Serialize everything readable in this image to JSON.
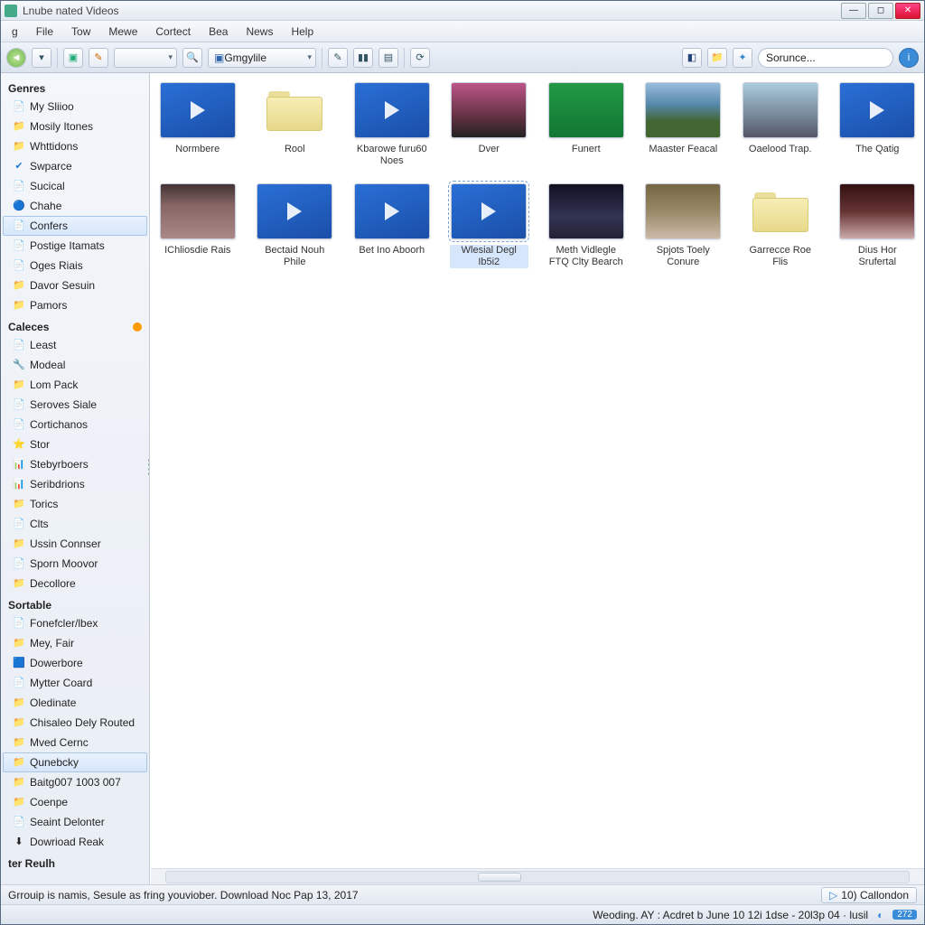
{
  "titlebar": {
    "title": "Lnube nated Videos"
  },
  "menu": {
    "items": [
      "File",
      "Tow",
      "Mewe",
      "Cortect",
      "Bea",
      "News",
      "Help"
    ],
    "first_partial": "g"
  },
  "toolbar": {
    "dropdown1_label": "",
    "dropdown2_label": "Gmgylile",
    "search_placeholder": "Sorunce..."
  },
  "sidebar": {
    "genres_header": "Genres",
    "genres": [
      {
        "icon": "📄",
        "label": "My Sliioo"
      },
      {
        "icon": "📁",
        "label": "Mosily Itones"
      },
      {
        "icon": "📁",
        "label": "Whttidons"
      },
      {
        "icon": "✔",
        "label": "Swparce",
        "blue": true
      },
      {
        "icon": "📄",
        "label": "Sucical"
      },
      {
        "icon": "🔵",
        "label": "Chahe"
      },
      {
        "icon": "📄",
        "label": "Confers",
        "selected": true
      },
      {
        "icon": "📄",
        "label": "Postige Itamats"
      },
      {
        "icon": "📄",
        "label": "Oges Riais"
      },
      {
        "icon": "📁",
        "label": "Davor Sesuin"
      },
      {
        "icon": "📁",
        "label": "Pamors"
      }
    ],
    "caleces_header": "Caleces",
    "caleces": [
      {
        "icon": "📄",
        "label": "Least"
      },
      {
        "icon": "🔧",
        "label": "Modeal"
      },
      {
        "icon": "📁",
        "label": "Lom Pack"
      },
      {
        "icon": "📄",
        "label": "Seroves Siale"
      },
      {
        "icon": "📄",
        "label": "Cortichanos"
      },
      {
        "icon": "⭐",
        "label": "Stor"
      },
      {
        "icon": "📊",
        "label": "Stebyrboers"
      },
      {
        "icon": "📊",
        "label": "Seribdrions"
      },
      {
        "icon": "📁",
        "label": "Torics"
      },
      {
        "icon": "📄",
        "label": "Clts"
      },
      {
        "icon": "📁",
        "label": "Ussin Connser"
      },
      {
        "icon": "📄",
        "label": "Sporn Moovor"
      },
      {
        "icon": "📁",
        "label": "Decollore"
      }
    ],
    "sortable_header": "Sortable",
    "sortable": [
      {
        "icon": "📄",
        "label": "Fonefcler/lbex"
      },
      {
        "icon": "📁",
        "label": "Mey, Fair"
      },
      {
        "icon": "🟦",
        "label": "Dowerbore"
      },
      {
        "icon": "📄",
        "label": "Mytter Coard"
      },
      {
        "icon": "📁",
        "label": "Oledinate"
      },
      {
        "icon": "📁",
        "label": "Chisaleo Dely Routed"
      },
      {
        "icon": "📁",
        "label": "Mved Cernc"
      },
      {
        "icon": "📁",
        "label": "Qunebcky",
        "selected": true
      },
      {
        "icon": "📁",
        "label": "Baitg007 1003 007"
      },
      {
        "icon": "📁",
        "label": "Coenpe"
      },
      {
        "icon": "📄",
        "label": "Seaint Delonter"
      },
      {
        "icon": "⬇",
        "label": "Dowrioad Reak"
      }
    ],
    "ter_header": "ter Reulh"
  },
  "grid": {
    "row1": [
      {
        "type": "video",
        "label": "Normbere"
      },
      {
        "type": "folder",
        "label": "Rool"
      },
      {
        "type": "video",
        "label": "Kbarowe furu60 Noes"
      },
      {
        "type": "photo",
        "pc": "p1",
        "label": "Dver"
      },
      {
        "type": "photo",
        "pc": "p2",
        "label": "Funert"
      },
      {
        "type": "photo",
        "pc": "p3",
        "label": "Maaster Feacal"
      },
      {
        "type": "photo",
        "pc": "p4",
        "label": "Oaelood Trap."
      },
      {
        "type": "video",
        "label": "The Qatig"
      }
    ],
    "row2": [
      {
        "type": "photo",
        "pc": "p5",
        "label": "IChliosdie Rais"
      },
      {
        "type": "video",
        "label": "Bectaid Nouh Phile"
      },
      {
        "type": "video",
        "label": "Bet Ino Aboorh"
      },
      {
        "type": "video",
        "label": "Wlesial Degl Ib5i2",
        "selected": true
      },
      {
        "type": "photo",
        "pc": "p6",
        "label": "Meth Vidlegle FTQ Clty Bearch"
      },
      {
        "type": "photo",
        "pc": "p7",
        "label": "Spjots Toely Conure"
      },
      {
        "type": "folder",
        "label": "Garrecce Roe Flis"
      },
      {
        "type": "photo",
        "pc": "p8",
        "label": "Dius Hor Srufertal"
      }
    ]
  },
  "status": {
    "left": "Grrouip is namis, Sesule as fring youviober. Download Noc Pap 13, 2017",
    "right_label": "10) Callondon",
    "bottom": "Weoding. AY : Acdret b June 10 12i 1dse - 20l3p 04 · lusil",
    "badge": "272"
  }
}
